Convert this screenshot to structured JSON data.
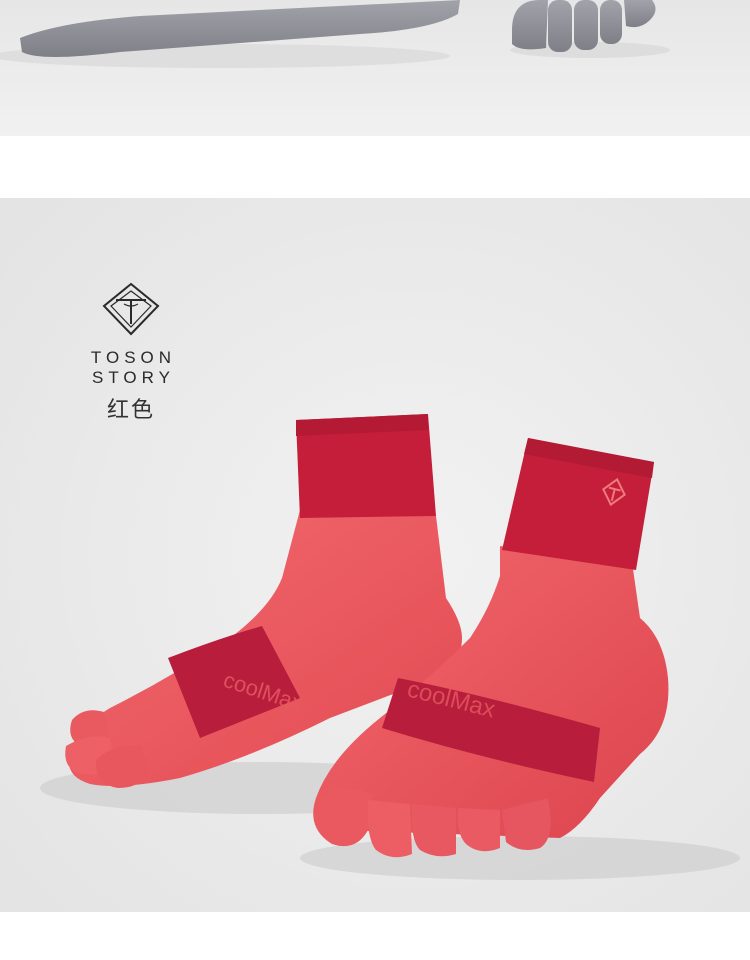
{
  "brand": {
    "logo_icon": "toson-diamond-logo-icon",
    "name": "TOSON STORY",
    "color_label": "红色"
  },
  "product_photo": {
    "sock_print_left": "coolMax",
    "sock_print_right": "coolMax"
  },
  "colors": {
    "sock_red": "#e8505a",
    "cuff_red": "#c41e3a",
    "band_red": "#b81d3c",
    "grey_sock": "#8e8e96",
    "background": "#eaeaea"
  }
}
